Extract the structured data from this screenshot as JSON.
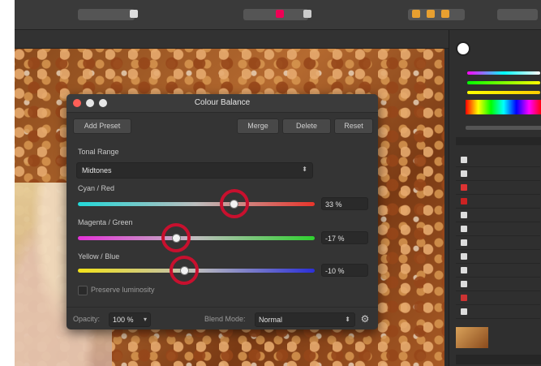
{
  "dialog": {
    "title": "Colour Balance",
    "buttons": {
      "add_preset": "Add Preset",
      "merge": "Merge",
      "delete": "Delete",
      "reset": "Reset"
    },
    "tonal_range": {
      "label": "Tonal Range",
      "value": "Midtones"
    },
    "sliders": [
      {
        "label": "Cyan / Red",
        "value": "33 %",
        "position": 0.66
      },
      {
        "label": "Magenta / Green",
        "value": "-17 %",
        "position": 0.415
      },
      {
        "label": "Yellow / Blue",
        "value": "-10 %",
        "position": 0.45
      }
    ],
    "preserve_luminosity": {
      "label": "Preserve luminosity",
      "checked": false
    },
    "footer": {
      "opacity_label": "Opacity:",
      "opacity_value": "100 %",
      "blend_label": "Blend Mode:",
      "blend_value": "Normal"
    }
  },
  "icons": [
    "gear-icon",
    "chevron-updown-icon",
    "chevron-down-icon"
  ],
  "colors": {
    "highlight_ring": "#c8102e",
    "dialog_bg": "#343434"
  }
}
